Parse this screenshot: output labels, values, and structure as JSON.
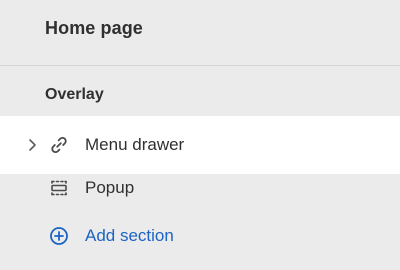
{
  "header": {
    "title": "Home page"
  },
  "group": {
    "heading": "Overlay"
  },
  "sections": [
    {
      "label": "Menu drawer",
      "icon": "link-icon",
      "selected": true,
      "expandable": true
    },
    {
      "label": "Popup",
      "icon": "popup-icon",
      "selected": false,
      "expandable": false
    }
  ],
  "add_section": {
    "label": "Add section",
    "icon": "plus-circle-icon",
    "color": "#1b63c4"
  },
  "colors": {
    "background": "#ebebeb",
    "selected_row": "#ffffff",
    "text": "#303030",
    "link": "#1b63c4"
  }
}
